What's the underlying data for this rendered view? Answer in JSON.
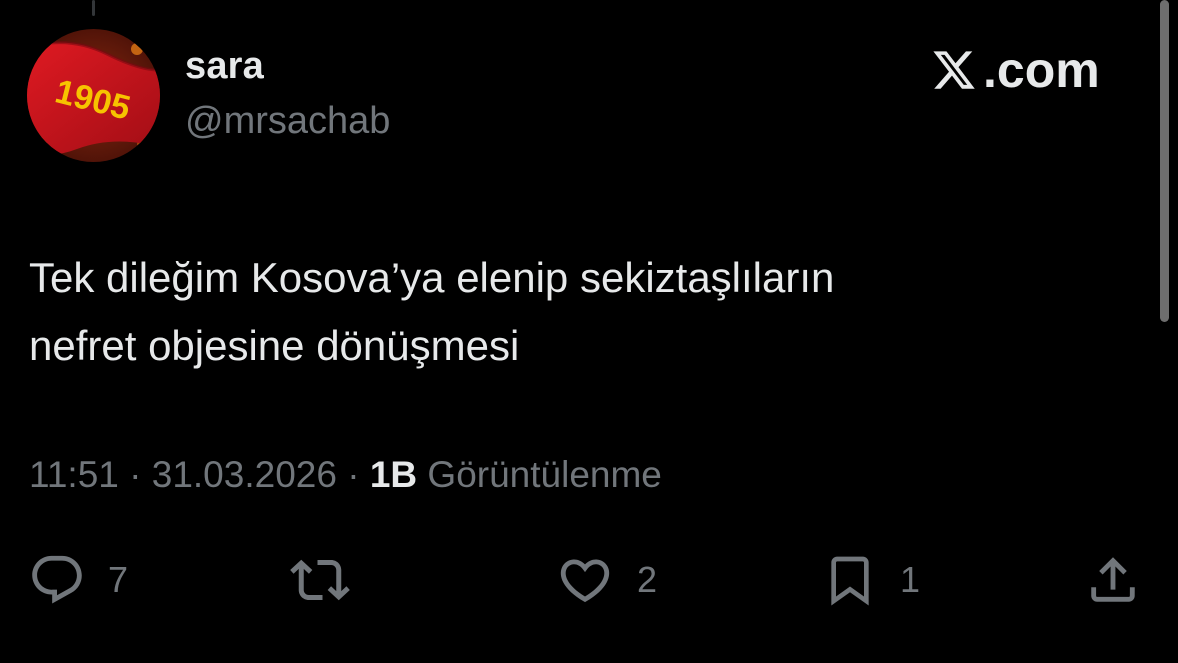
{
  "tweet": {
    "author": {
      "display_name": "sara",
      "handle": "@mrsachab",
      "avatar": {
        "icon": "avatar-flag-1905",
        "text": "1905",
        "colors": {
          "flag": "#c2121c",
          "text": "#f7c300"
        }
      }
    },
    "brand": {
      "icon": "x-logo-icon",
      "text": ".com"
    },
    "text_lines": [
      "Tek dileğim Kosova’ya elenip sekiztaşlıların",
      "nefret objesine dönüşmesi"
    ],
    "meta": {
      "time": "11:51",
      "separator": " · ",
      "date": "31.03.2026",
      "views_count": "1B",
      "views_label": " Görüntülenme"
    },
    "actions": {
      "reply": {
        "icon": "reply-icon",
        "count": "7"
      },
      "repost": {
        "icon": "repost-icon",
        "count": ""
      },
      "like": {
        "icon": "heart-icon",
        "count": "2"
      },
      "bookmark": {
        "icon": "bookmark-icon",
        "count": "1"
      },
      "share": {
        "icon": "share-icon",
        "count": ""
      }
    }
  },
  "colors": {
    "background": "#000000",
    "primary_text": "#e7e9ea",
    "secondary_text": "#71767b",
    "icon": "#71767b"
  }
}
